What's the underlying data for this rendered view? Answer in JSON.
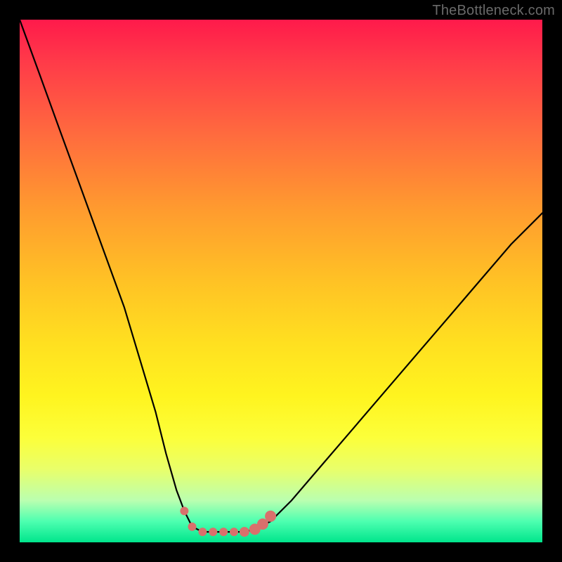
{
  "watermark": {
    "text": "TheBottleneck.com"
  },
  "chart_data": {
    "type": "line",
    "title": "",
    "xlabel": "",
    "ylabel": "",
    "xlim": [
      0,
      100
    ],
    "ylim": [
      0,
      100
    ],
    "grid": false,
    "legend": false,
    "series": [
      {
        "name": "bottleneck-curve",
        "x": [
          0,
          4,
          8,
          12,
          16,
          20,
          23,
          26,
          28,
          30,
          31.5,
          33,
          35,
          38,
          40,
          43,
          45,
          48,
          52,
          58,
          64,
          70,
          76,
          82,
          88,
          94,
          100
        ],
        "y": [
          100,
          89,
          78,
          67,
          56,
          45,
          35,
          25,
          17,
          10,
          6,
          3,
          2,
          2,
          2,
          2,
          2.5,
          4,
          8,
          15,
          22,
          29,
          36,
          43,
          50,
          57,
          63
        ]
      }
    ],
    "markers": {
      "name": "valley-markers",
      "color": "#d9706c",
      "points_x": [
        31.5,
        33,
        35,
        37,
        39,
        41,
        43,
        45,
        46.5,
        48
      ],
      "points_y": [
        6,
        3,
        2,
        2,
        2,
        2,
        2,
        2.5,
        3.5,
        5
      ],
      "radius": [
        6,
        6,
        6,
        6,
        6,
        6,
        7,
        8,
        8,
        8
      ]
    },
    "background_gradient": {
      "stops": [
        {
          "pos": 0.0,
          "color": "#ff1a4b"
        },
        {
          "pos": 0.36,
          "color": "#ff9a2f"
        },
        {
          "pos": 0.72,
          "color": "#fff41f"
        },
        {
          "pos": 0.96,
          "color": "#4dffb0"
        },
        {
          "pos": 1.0,
          "color": "#00e58c"
        }
      ]
    }
  }
}
